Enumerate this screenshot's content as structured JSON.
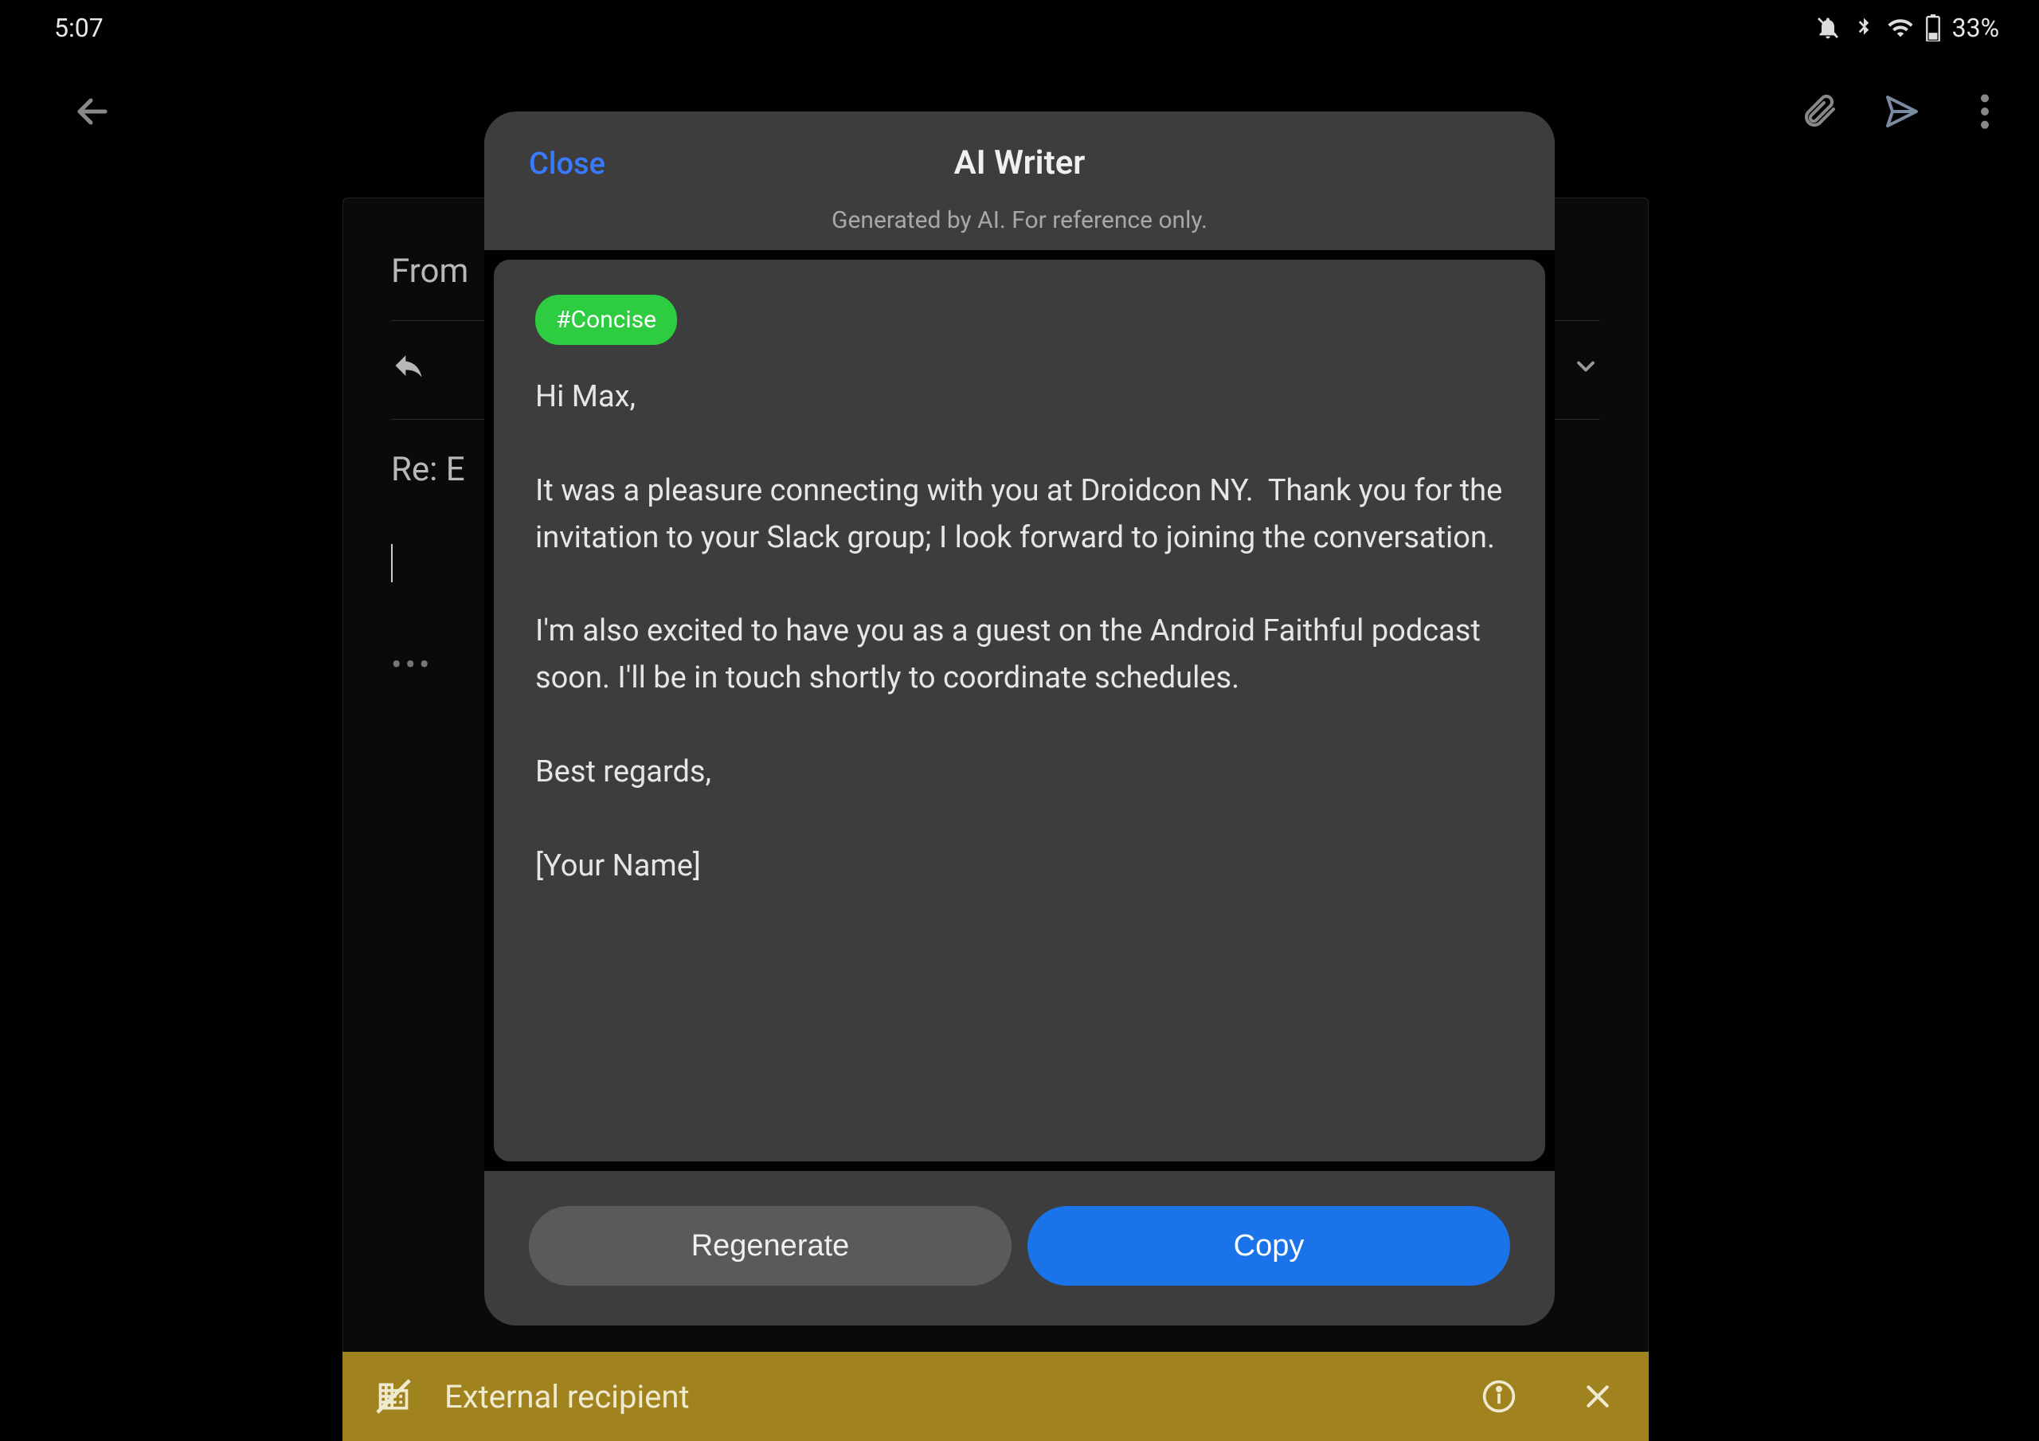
{
  "statusbar": {
    "time": "5:07",
    "battery_pct": "33%"
  },
  "appbar": {
    "back": "Back"
  },
  "compose": {
    "from_label": "From",
    "subject": "Re: E",
    "more": "•••"
  },
  "ext_banner": {
    "text": "External recipient"
  },
  "modal": {
    "close_label": "Close",
    "title": "AI Writer",
    "subtitle": "Generated by AI. For reference only.",
    "tag": "#Concise",
    "body": "Hi Max,\n\nIt was a pleasure connecting with you at Droidcon NY.  Thank you for the invitation to your Slack group; I look forward to joining the conversation.\n\nI'm also excited to have you as a guest on the Android Faithful podcast soon. I'll be in touch shortly to coordinate schedules.\n\nBest regards,\n\n[Your Name]",
    "regenerate_label": "Regenerate",
    "copy_label": "Copy"
  }
}
